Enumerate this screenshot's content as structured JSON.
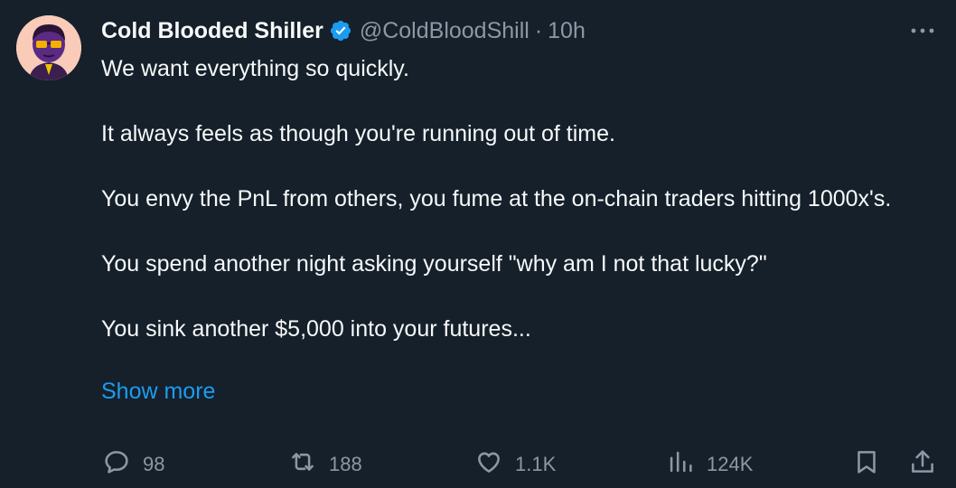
{
  "tweet": {
    "author_name": "Cold Blooded Shiller",
    "handle": "@ColdBloodShill",
    "separator": "·",
    "time": "10h",
    "paragraphs": [
      "We want everything so quickly.",
      "It always feels as though you're running out of time.",
      "You envy the PnL from others, you fume at the on-chain traders hitting 1000x's.",
      "You spend another night asking yourself \"why am I not that lucky?\"",
      "You sink another $5,000 into your futures..."
    ],
    "show_more": "Show more"
  },
  "actions": {
    "replies": "98",
    "reposts": "188",
    "likes": "1.1K",
    "views": "124K"
  },
  "colors": {
    "background": "#15202b",
    "text": "#f7f9f9",
    "muted": "#8b98a5",
    "accent": "#1d9bf0",
    "verified_badge": "#1d9bf0"
  },
  "icons": [
    "avatar",
    "verified-badge-icon",
    "more-icon",
    "reply-icon",
    "repost-icon",
    "like-icon",
    "views-icon",
    "bookmark-icon",
    "share-icon"
  ]
}
